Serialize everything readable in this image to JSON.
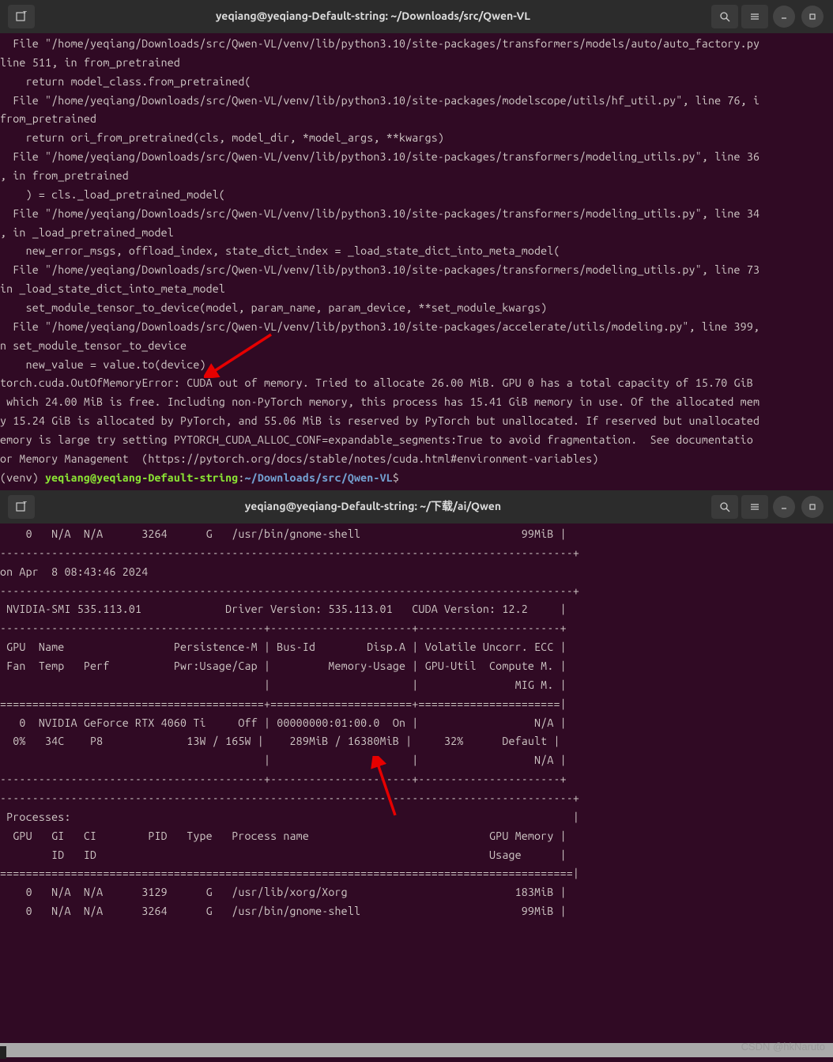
{
  "window1": {
    "title": "yeqiang@yeqiang-Default-string: ~/Downloads/src/Qwen-VL",
    "traceback": [
      "  File \"/home/yeqiang/Downloads/src/Qwen-VL/venv/lib/python3.10/site-packages/transformers/models/auto/auto_factory.py",
      "line 511, in from_pretrained",
      "    return model_class.from_pretrained(",
      "  File \"/home/yeqiang/Downloads/src/Qwen-VL/venv/lib/python3.10/site-packages/modelscope/utils/hf_util.py\", line 76, i",
      "from_pretrained",
      "    return ori_from_pretrained(cls, model_dir, *model_args, **kwargs)",
      "  File \"/home/yeqiang/Downloads/src/Qwen-VL/venv/lib/python3.10/site-packages/transformers/modeling_utils.py\", line 36",
      ", in from_pretrained",
      "    ) = cls._load_pretrained_model(",
      "  File \"/home/yeqiang/Downloads/src/Qwen-VL/venv/lib/python3.10/site-packages/transformers/modeling_utils.py\", line 34",
      ", in _load_pretrained_model",
      "    new_error_msgs, offload_index, state_dict_index = _load_state_dict_into_meta_model(",
      "  File \"/home/yeqiang/Downloads/src/Qwen-VL/venv/lib/python3.10/site-packages/transformers/modeling_utils.py\", line 73",
      "in _load_state_dict_into_meta_model",
      "    set_module_tensor_to_device(model, param_name, param_device, **set_module_kwargs)",
      "  File \"/home/yeqiang/Downloads/src/Qwen-VL/venv/lib/python3.10/site-packages/accelerate/utils/modeling.py\", line 399,",
      "n set_module_tensor_to_device",
      "    new_value = value.to(device)",
      "torch.cuda.OutOfMemoryError: CUDA out of memory. Tried to allocate 26.00 MiB. GPU 0 has a total capacity of 15.70 GiB ",
      " which 24.00 MiB is free. Including non-PyTorch memory, this process has 15.41 GiB memory in use. Of the allocated mem",
      "y 15.24 GiB is allocated by PyTorch, and 55.06 MiB is reserved by PyTorch but unallocated. If reserved but unallocated",
      "emory is large try setting PYTORCH_CUDA_ALLOC_CONF=expandable_segments:True to avoid fragmentation.  See documentatio",
      "or Memory Management  (https://pytorch.org/docs/stable/notes/cuda.html#environment-variables)"
    ],
    "prompt_prefix": "(venv) ",
    "prompt_user": "yeqiang@yeqiang-Default-string",
    "prompt_sep": ":",
    "prompt_path": "~/Downloads/src/Qwen-VL",
    "prompt_dollar": "$"
  },
  "window2": {
    "title": "yeqiang@yeqiang-Default-string: ~/下载/ai/Qwen",
    "lines": [
      "    0   N/A  N/A      3264      G   /usr/bin/gnome-shell                         99MiB |",
      "-----------------------------------------------------------------------------------------+",
      "on Apr  8 08:43:46 2024",
      "-----------------------------------------------------------------------------------------+",
      " NVIDIA-SMI 535.113.01             Driver Version: 535.113.01   CUDA Version: 12.2     |",
      "-----------------------------------------+----------------------+----------------------+",
      " GPU  Name                 Persistence-M | Bus-Id        Disp.A | Volatile Uncorr. ECC |",
      " Fan  Temp   Perf          Pwr:Usage/Cap |         Memory-Usage | GPU-Util  Compute M. |",
      "                                         |                      |               MIG M. |",
      "=========================================+======================+======================|",
      "   0  NVIDIA GeForce RTX 4060 Ti     Off | 00000000:01:00.0  On |                  N/A |",
      "  0%   34C    P8             13W / 165W |    289MiB / 16380MiB |     32%      Default |",
      "                                         |                      |                  N/A |",
      "-----------------------------------------+----------------------+----------------------+",
      "",
      "-----------------------------------------------------------------------------------------+",
      " Processes:                                                                              |",
      "  GPU   GI   CI        PID   Type   Process name                            GPU Memory |",
      "        ID   ID                                                             Usage      |",
      "=========================================================================================|",
      "    0   N/A  N/A      3129      G   /usr/lib/xorg/Xorg                          183MiB |",
      "    0   N/A  N/A      3264      G   /usr/bin/gnome-shell                         99MiB |"
    ]
  },
  "watermark": "CSDN @hkNaruto"
}
